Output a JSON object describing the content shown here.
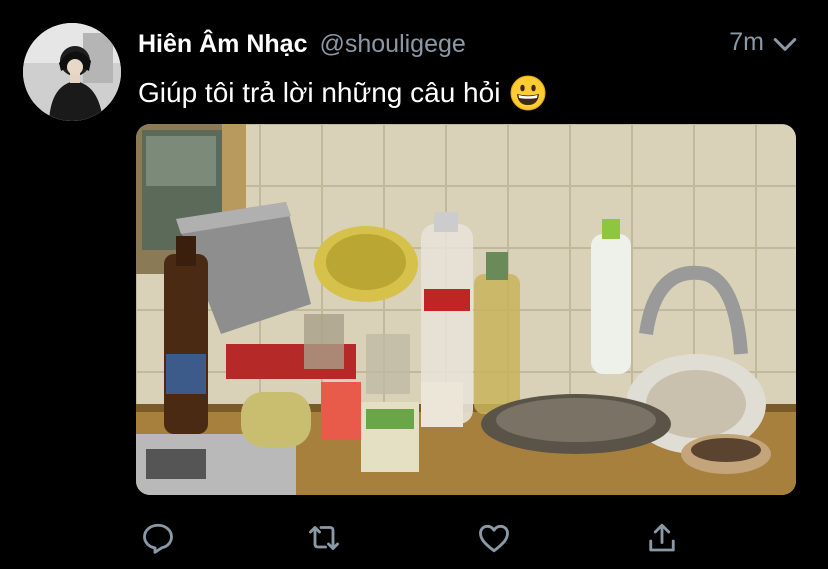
{
  "tweet": {
    "display_name": "Hiên Âm Nhạc",
    "handle": "@shouligege",
    "timestamp": "7m",
    "text": "Giúp tôi trả lời những câu hỏi",
    "emoji": "grinning-face-emoji",
    "avatar": "profile-photo",
    "media": "messy-kitchen-counter-photo"
  },
  "actions": {
    "reply_icon": "reply-icon",
    "retweet_icon": "retweet-icon",
    "like_icon": "heart-icon",
    "share_icon": "share-icon"
  },
  "colors": {
    "background": "#000000",
    "text_primary": "#ffffff",
    "text_secondary": "#8b98a5",
    "icon": "#8b98a5"
  }
}
